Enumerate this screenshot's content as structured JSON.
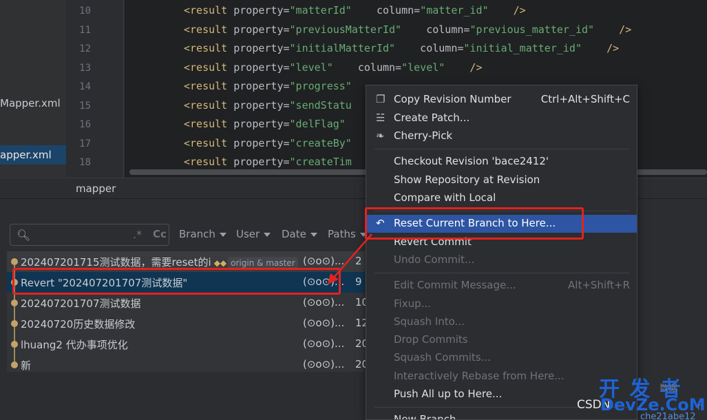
{
  "project_tree": {
    "items": [
      {
        "label": "Mapper.xml",
        "selected": false
      },
      {
        "label": "apper.xml",
        "selected": true
      }
    ]
  },
  "editor": {
    "line_numbers": [
      "10",
      "11",
      "12",
      "13",
      "14",
      "15",
      "16",
      "17",
      "18"
    ],
    "lines": [
      {
        "tag": "<result",
        "attr1": " property=",
        "val1": "\"matterId\"",
        "attr2": "    column=",
        "val2": "\"matter_id\"",
        "end": "    />"
      },
      {
        "tag": "<result",
        "attr1": " property=",
        "val1": "\"previousMatterId\"",
        "attr2": "    column=",
        "val2": "\"previous_matter_id\"",
        "end": "    />"
      },
      {
        "tag": "<result",
        "attr1": " property=",
        "val1": "\"initialMatterId\"",
        "attr2": "    column=",
        "val2": "\"initial_matter_id\"",
        "end": "    />"
      },
      {
        "tag": "<result",
        "attr1": " property=",
        "val1": "\"level\"",
        "attr2": "    column=",
        "val2": "\"level\"",
        "end": "    />"
      },
      {
        "tag": "<result",
        "attr1": " property=",
        "val1": "\"progress\"",
        "attr2": "",
        "val2": "",
        "end": ""
      },
      {
        "tag": "<result",
        "attr1": " property=",
        "val1": "\"sendStatu",
        "attr2": "",
        "val2": "",
        "end": ""
      },
      {
        "tag": "<result",
        "attr1": " property=",
        "val1": "\"delFlag\"",
        "attr2": "",
        "val2": "",
        "end": ""
      },
      {
        "tag": "<result",
        "attr1": " property=",
        "val1": "\"createBy\"",
        "attr2": "",
        "val2": "",
        "end": ""
      },
      {
        "tag": "<result",
        "attr1": " property=",
        "val1": "\"createTim",
        "attr2": "",
        "val2": "",
        "end": ""
      }
    ],
    "breadcrumb": "mapper"
  },
  "git_log": {
    "search_placeholder": "",
    "regex_label": ".*",
    "case_label": "Cc",
    "filters": {
      "branch": "Branch",
      "user": "User",
      "date": "Date",
      "paths": "Paths"
    },
    "commits": [
      {
        "message": "202407201715测试数据，需要reset的i",
        "refs": "origin & master",
        "author": "(⊙o⊙)...",
        "date": "2",
        "state": "dim"
      },
      {
        "message": "Revert \"202407201707测试数据\"",
        "refs": "",
        "author": "(⊙o⊙)...",
        "date": "9",
        "state": "selected"
      },
      {
        "message": "202407201707测试数据",
        "refs": "",
        "author": "(⊙o⊙)...",
        "date": "10",
        "state": ""
      },
      {
        "message": "20240720历史数据修改",
        "refs": "",
        "author": "(⊙o⊙)...",
        "date": "12",
        "state": ""
      },
      {
        "message": "lhuang2 代办事项优化",
        "refs": "",
        "author": "(⊙o⊙)...",
        "date": "20",
        "state": ""
      },
      {
        "message": "新",
        "refs": "",
        "author": "(⊙o⊙)...",
        "date": "20",
        "state": ""
      }
    ]
  },
  "context_menu": {
    "items": [
      {
        "label": "Copy Revision Number",
        "shortcut": "Ctrl+Alt+Shift+C",
        "icon": "copy-icon",
        "state": ""
      },
      {
        "label": "Create Patch...",
        "shortcut": "",
        "icon": "patch-icon",
        "state": ""
      },
      {
        "label": "Cherry-Pick",
        "shortcut": "",
        "icon": "cherry-icon",
        "state": ""
      },
      {
        "label": "Checkout Revision 'bace2412'",
        "shortcut": "",
        "icon": "",
        "state": ""
      },
      {
        "label": "Show Repository at Revision",
        "shortcut": "",
        "icon": "",
        "state": ""
      },
      {
        "label": "Compare with Local",
        "shortcut": "",
        "icon": "",
        "state": ""
      },
      {
        "label": "Reset Current Branch to Here...",
        "shortcut": "",
        "icon": "undo-icon",
        "state": "active"
      },
      {
        "label": "Revert Commit",
        "shortcut": "",
        "icon": "",
        "state": ""
      },
      {
        "label": "Undo Commit...",
        "shortcut": "",
        "icon": "",
        "state": "disabled"
      },
      {
        "label": "Edit Commit Message...",
        "shortcut": "Alt+Shift+R",
        "icon": "",
        "state": "disabled"
      },
      {
        "label": "Fixup...",
        "shortcut": "",
        "icon": "",
        "state": "disabled"
      },
      {
        "label": "Squash Into...",
        "shortcut": "",
        "icon": "",
        "state": "disabled"
      },
      {
        "label": "Drop Commits",
        "shortcut": "",
        "icon": "",
        "state": "disabled"
      },
      {
        "label": "Squash Commits...",
        "shortcut": "",
        "icon": "",
        "state": "disabled"
      },
      {
        "label": "Interactively Rebase from Here...",
        "shortcut": "",
        "icon": "",
        "state": "disabled"
      },
      {
        "label": "Push All up to Here...",
        "shortcut": "",
        "icon": "",
        "state": ""
      },
      {
        "label": "New Branch...",
        "shortcut": "",
        "icon": "",
        "state": ""
      }
    ]
  },
  "watermark": {
    "csdn": "CSDN",
    "brand_cn": "开 发 者",
    "brand_en": "DevZe.CoM",
    "small_cn": "数据",
    "small_hash": "che21abe12",
    "small_r": "r"
  },
  "colors": {
    "accent_selection": "#2e55a3",
    "annotation_red": "#e3231e",
    "graph_gold": "#c2a36a"
  }
}
